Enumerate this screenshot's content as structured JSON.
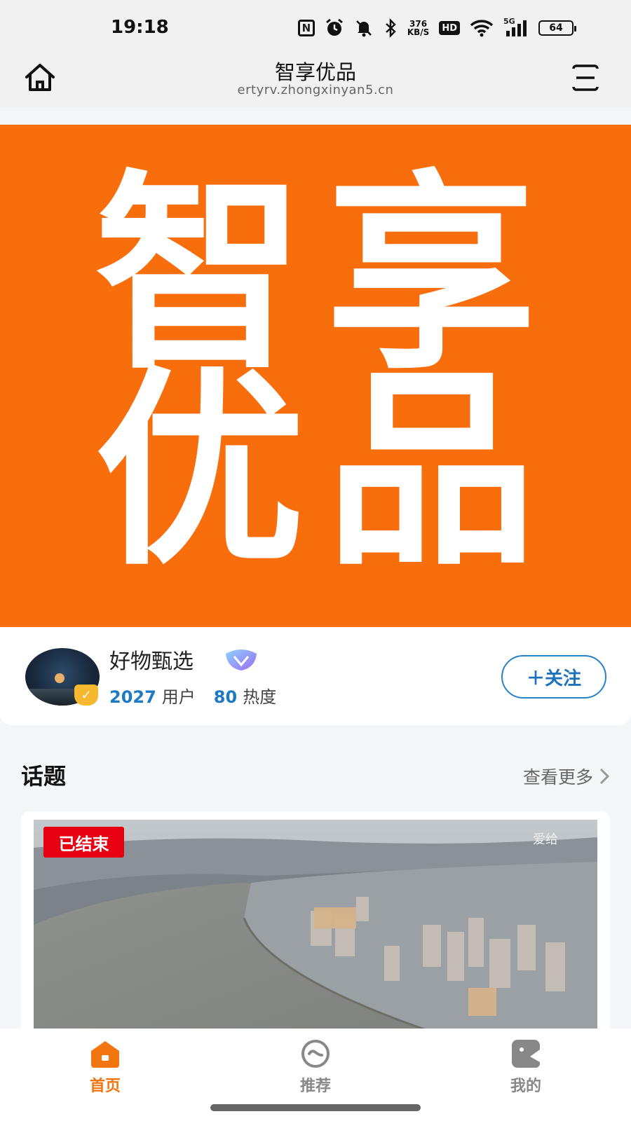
{
  "status_bar": {
    "time": "19:18",
    "network_speed_value": "376",
    "network_speed_unit": "KB/S",
    "hd_label": "HD",
    "signal_label": "5G",
    "battery": "64"
  },
  "header": {
    "title": "智享优品",
    "url": "ertyrv.zhongxinyan5.cn"
  },
  "banner": {
    "chars": [
      "智",
      "享",
      "优",
      "品"
    ],
    "background": "#f86d0c"
  },
  "profile": {
    "name": "好物甄选",
    "users_count": "2027",
    "users_label": "用户",
    "heat_count": "80",
    "heat_label": "热度",
    "follow_label": "＋关注"
  },
  "topics": {
    "title": "话题",
    "see_more": "查看更多",
    "card": {
      "status_tag": "已结束",
      "watermark": "爱给"
    }
  },
  "tabbar": {
    "items": [
      {
        "label": "首页",
        "icon": "home-icon"
      },
      {
        "label": "推荐",
        "icon": "recommend-icon"
      },
      {
        "label": "我的",
        "icon": "profile-icon"
      }
    ],
    "active_color": "#f2750f"
  }
}
